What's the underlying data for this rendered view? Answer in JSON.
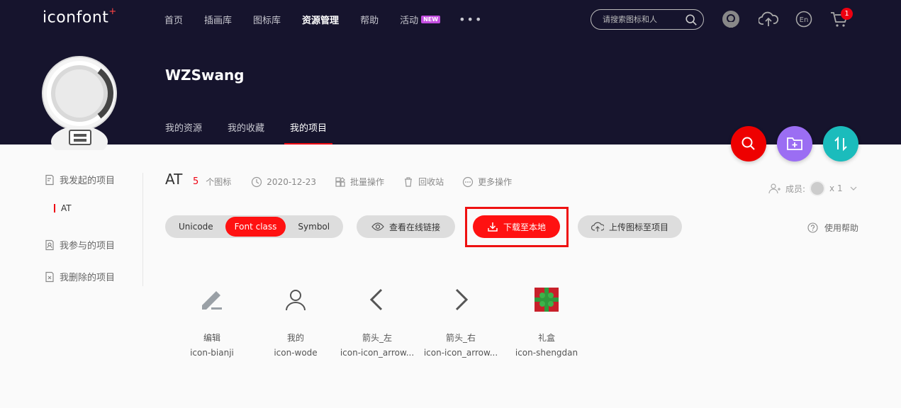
{
  "header": {
    "logo": "iconfont",
    "nav": [
      {
        "label": "首页"
      },
      {
        "label": "插画库"
      },
      {
        "label": "图标库"
      },
      {
        "label": "资源管理"
      },
      {
        "label": "帮助"
      },
      {
        "label": "活动"
      }
    ],
    "new_badge": "NEW",
    "more": "•••",
    "search_placeholder": "请搜索图标和人",
    "cart_count": "1",
    "lang": "En"
  },
  "profile": {
    "username": "WZSwang",
    "tabs": [
      {
        "label": "我的资源"
      },
      {
        "label": "我的收藏"
      },
      {
        "label": "我的项目"
      }
    ]
  },
  "sidebar": {
    "items": [
      {
        "label": "我发起的项目"
      },
      {
        "label": "我参与的项目"
      },
      {
        "label": "我删除的项目"
      }
    ],
    "active_project": "AT"
  },
  "project": {
    "name": "AT",
    "icon_count": "5",
    "icon_count_label": "个图标",
    "date": "2020-12-23",
    "batch": "批量操作",
    "recycle": "回收站",
    "more_ops": "更多操作",
    "members_label": "成员:",
    "members_count": "x 1"
  },
  "toolbar": {
    "segments": [
      {
        "label": "Unicode"
      },
      {
        "label": "Font class"
      },
      {
        "label": "Symbol"
      }
    ],
    "view_link": "查看在线链接",
    "download": "下载至本地",
    "upload": "上传图标至项目",
    "help": "使用帮助"
  },
  "icons": [
    {
      "name": "编辑",
      "class": "icon-bianji",
      "glyph": "pencil-icon"
    },
    {
      "name": "我的",
      "class": "icon-wode",
      "glyph": "user-icon"
    },
    {
      "name": "箭头_左",
      "class": "icon-icon_arrow...",
      "glyph": "arrow-left-icon"
    },
    {
      "name": "箭头_右",
      "class": "icon-icon_arrow...",
      "glyph": "arrow-right-icon"
    },
    {
      "name": "礼盒",
      "class": "icon-shengdan",
      "glyph": "gift-icon"
    }
  ],
  "colors": {
    "header_bg": "#16142d",
    "accent_red": "#ff1111",
    "fab_search": "#ee0000",
    "fab_folder": "#9b6ef3",
    "fab_sort": "#1bbcbc"
  }
}
